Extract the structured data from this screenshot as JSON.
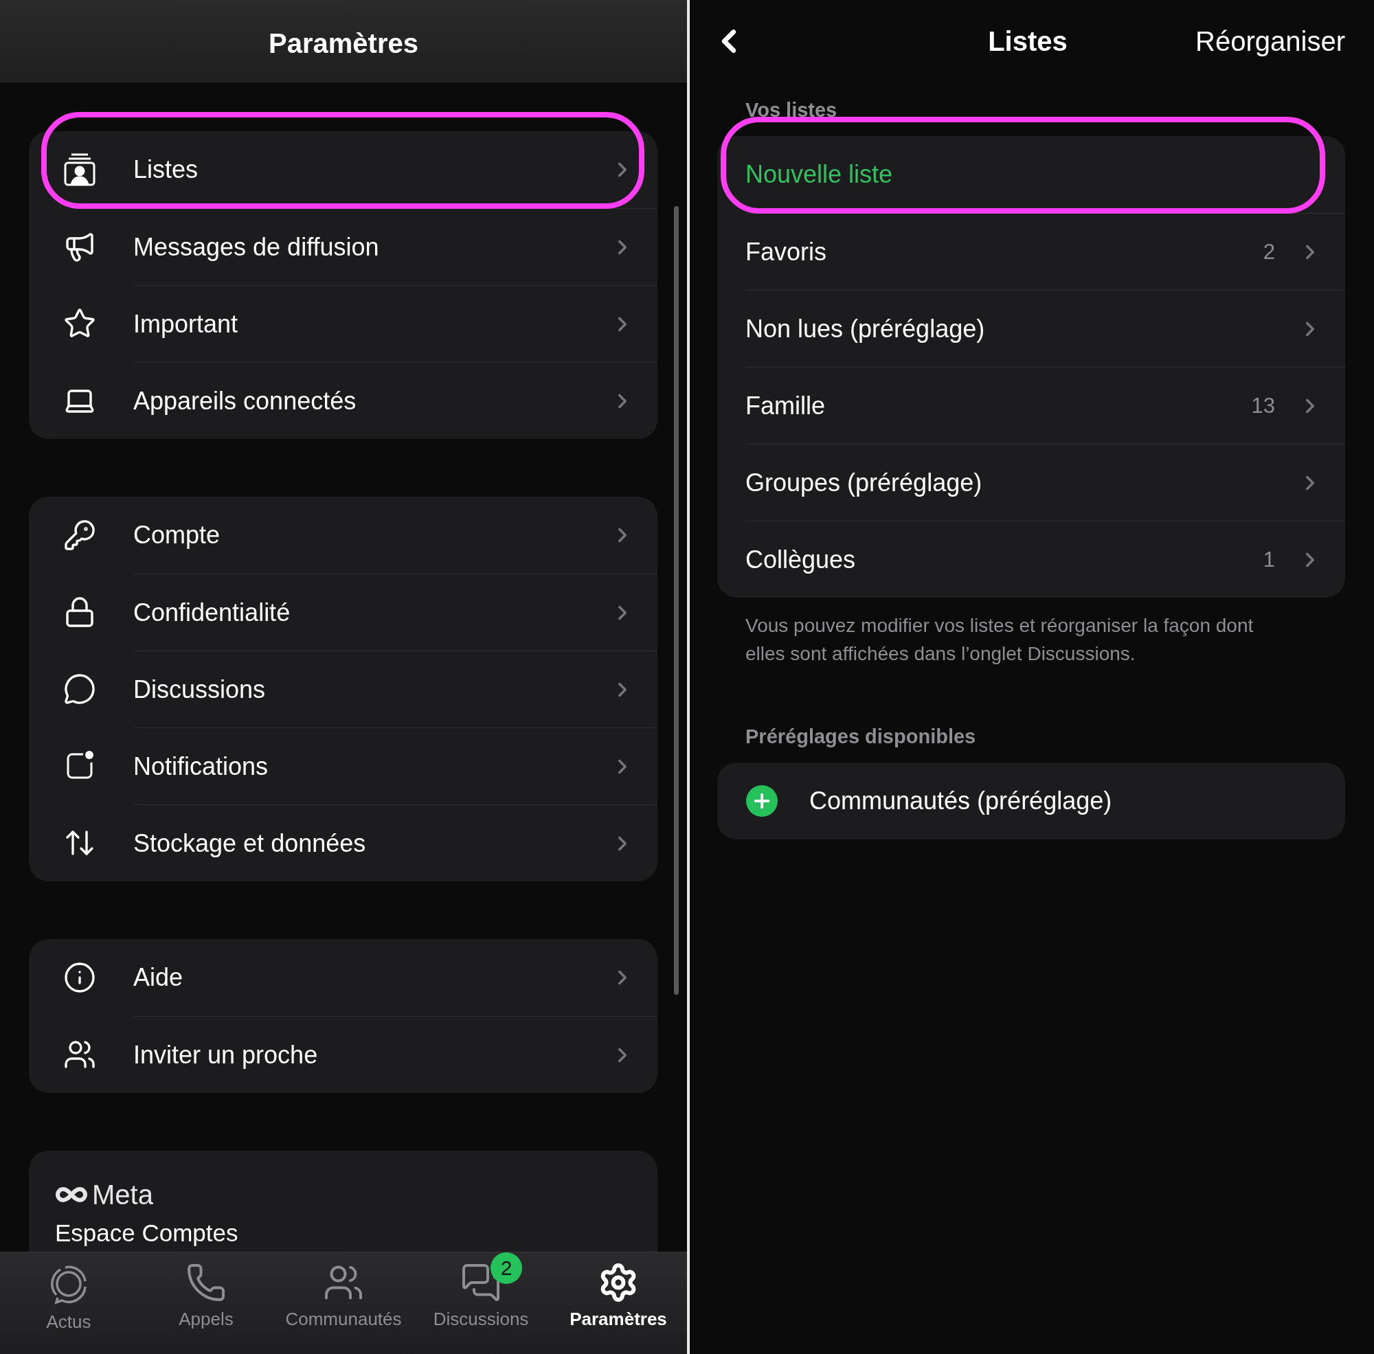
{
  "left": {
    "title": "Paramètres",
    "groups": [
      {
        "items": [
          {
            "label": "Listes",
            "highlighted": true
          },
          {
            "label": "Messages de diffusion",
            "highlighted": false
          },
          {
            "label": "Important",
            "highlighted": false
          },
          {
            "label": "Appareils connectés",
            "highlighted": false
          }
        ]
      },
      {
        "items": [
          {
            "label": "Compte",
            "highlighted": false
          },
          {
            "label": "Confidentialité",
            "highlighted": false
          },
          {
            "label": "Discussions",
            "highlighted": false
          },
          {
            "label": "Notifications",
            "highlighted": false
          },
          {
            "label": "Stockage et données",
            "highlighted": false
          }
        ]
      },
      {
        "items": [
          {
            "label": "Aide",
            "highlighted": false
          },
          {
            "label": "Inviter un proche",
            "highlighted": false
          }
        ]
      }
    ],
    "meta_card": {
      "brand": "Meta",
      "label": "Espace Comptes"
    }
  },
  "tab_bar": [
    {
      "label": "Actus",
      "selected": false
    },
    {
      "label": "Appels",
      "selected": false
    },
    {
      "label": "Communautés",
      "selected": false
    },
    {
      "label": "Discussions",
      "selected": false,
      "badge": "2"
    },
    {
      "label": "Paramètres",
      "selected": true
    }
  ],
  "right": {
    "title": "Listes",
    "action": "Réorganiser",
    "sections": [
      {
        "header": "Vos listes",
        "items": [
          {
            "kind": "action",
            "label": "Nouvelle liste",
            "highlighted": true
          },
          {
            "kind": "list",
            "label": "Favoris",
            "count": "2",
            "highlighted": false
          },
          {
            "kind": "list",
            "label": "Non lues (préréglage)",
            "highlighted": false
          },
          {
            "kind": "list",
            "label": "Famille",
            "count": "13",
            "highlighted": false
          },
          {
            "kind": "list",
            "label": "Groupes (préréglage)",
            "highlighted": false
          },
          {
            "kind": "list",
            "label": "Collègues",
            "count": "1",
            "highlighted": false
          }
        ],
        "footer": "Vous pouvez modifier vos listes et réorganiser la façon dont elles sont affichées dans l’onglet Discussions."
      },
      {
        "header": "Préréglages disponibles",
        "items": [
          {
            "kind": "add",
            "label": "Communautés (préréglage)",
            "highlighted": false
          }
        ]
      }
    ]
  }
}
